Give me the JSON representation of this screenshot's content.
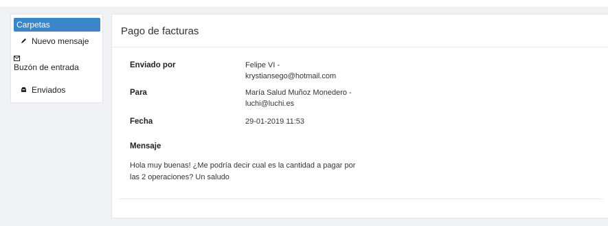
{
  "sidebar": {
    "header": "Carpetas",
    "items": [
      {
        "label": "Nuevo mensaje",
        "icon": "pencil-icon"
      },
      {
        "label": "Buzón de entrada",
        "icon": "envelope-icon"
      },
      {
        "label": "Enviados",
        "icon": "sent-box-icon"
      }
    ]
  },
  "message": {
    "title": "Pago de facturas",
    "from_label": "Enviado por",
    "from_value": "Felipe VI - krystiansego@hotmail.com",
    "to_label": "Para",
    "to_value": "María Salud Muñoz Monedero - luchi@luchi.es",
    "date_label": "Fecha",
    "date_value": "29-01-2019 11:53",
    "body_label": "Mensaje",
    "body": "Hola muy buenas! ¿Me podría decir cual es la cantidad a pagar por las 2 operaciones? Un saludo"
  },
  "colors": {
    "accent": "#3a86c8",
    "background": "#f1f2f5"
  }
}
